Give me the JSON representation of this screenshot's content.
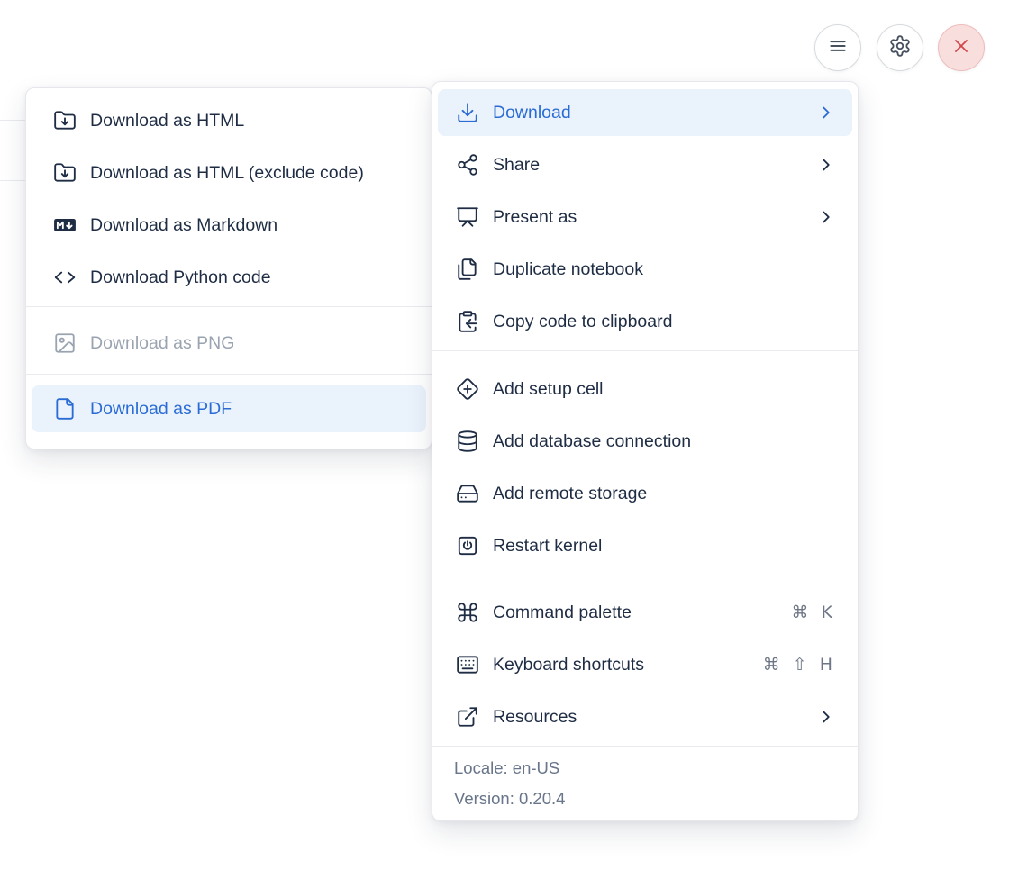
{
  "toolbar": {
    "hamburger_button": {
      "icon": "hamburger-icon"
    },
    "settings_button": {
      "icon": "gear-icon"
    },
    "close_button": {
      "icon": "close-icon",
      "accent": "#d24848"
    }
  },
  "download_submenu": {
    "items": [
      {
        "label": "Download as HTML",
        "icon": "folder-download-icon",
        "state": "normal"
      },
      {
        "label": "Download as HTML (exclude code)",
        "icon": "folder-download-icon",
        "state": "normal"
      },
      {
        "label": "Download as Markdown",
        "icon": "markdown-icon",
        "state": "normal"
      },
      {
        "label": "Download Python code",
        "icon": "code-icon",
        "state": "normal"
      },
      {
        "label": "Download as PNG",
        "icon": "image-icon",
        "state": "disabled"
      },
      {
        "label": "Download as PDF",
        "icon": "file-icon",
        "state": "highlighted"
      }
    ]
  },
  "main_menu": {
    "items": [
      {
        "label": "Download",
        "icon": "download-icon",
        "has_submenu": true,
        "state": "highlighted"
      },
      {
        "label": "Share",
        "icon": "share-icon",
        "has_submenu": true
      },
      {
        "label": "Present as",
        "icon": "presentation-icon",
        "has_submenu": true
      },
      {
        "label": "Duplicate notebook",
        "icon": "duplicate-icon"
      },
      {
        "label": "Copy code to clipboard",
        "icon": "clipboard-copy-icon"
      },
      {
        "label": "Add setup cell",
        "icon": "diamond-plus-icon"
      },
      {
        "label": "Add database connection",
        "icon": "database-icon"
      },
      {
        "label": "Add remote storage",
        "icon": "hard-drive-icon"
      },
      {
        "label": "Restart kernel",
        "icon": "power-icon"
      },
      {
        "label": "Command palette",
        "icon": "command-icon",
        "shortcut": "⌘ K"
      },
      {
        "label": "Keyboard shortcuts",
        "icon": "keyboard-icon",
        "shortcut": "⌘ ⇧ H"
      },
      {
        "label": "Resources",
        "icon": "external-link-icon",
        "has_submenu": true
      }
    ],
    "footer": {
      "locale": "Locale: en-US",
      "version": "Version: 0.20.4"
    }
  },
  "colors": {
    "accent_blue": "#2b6cd4",
    "highlight_bg": "#eaf2fc",
    "text": "#1e2c44",
    "muted_gray": "#6e7a8c",
    "disabled_gray": "#9aa3b0",
    "danger_red": "#d24848"
  }
}
